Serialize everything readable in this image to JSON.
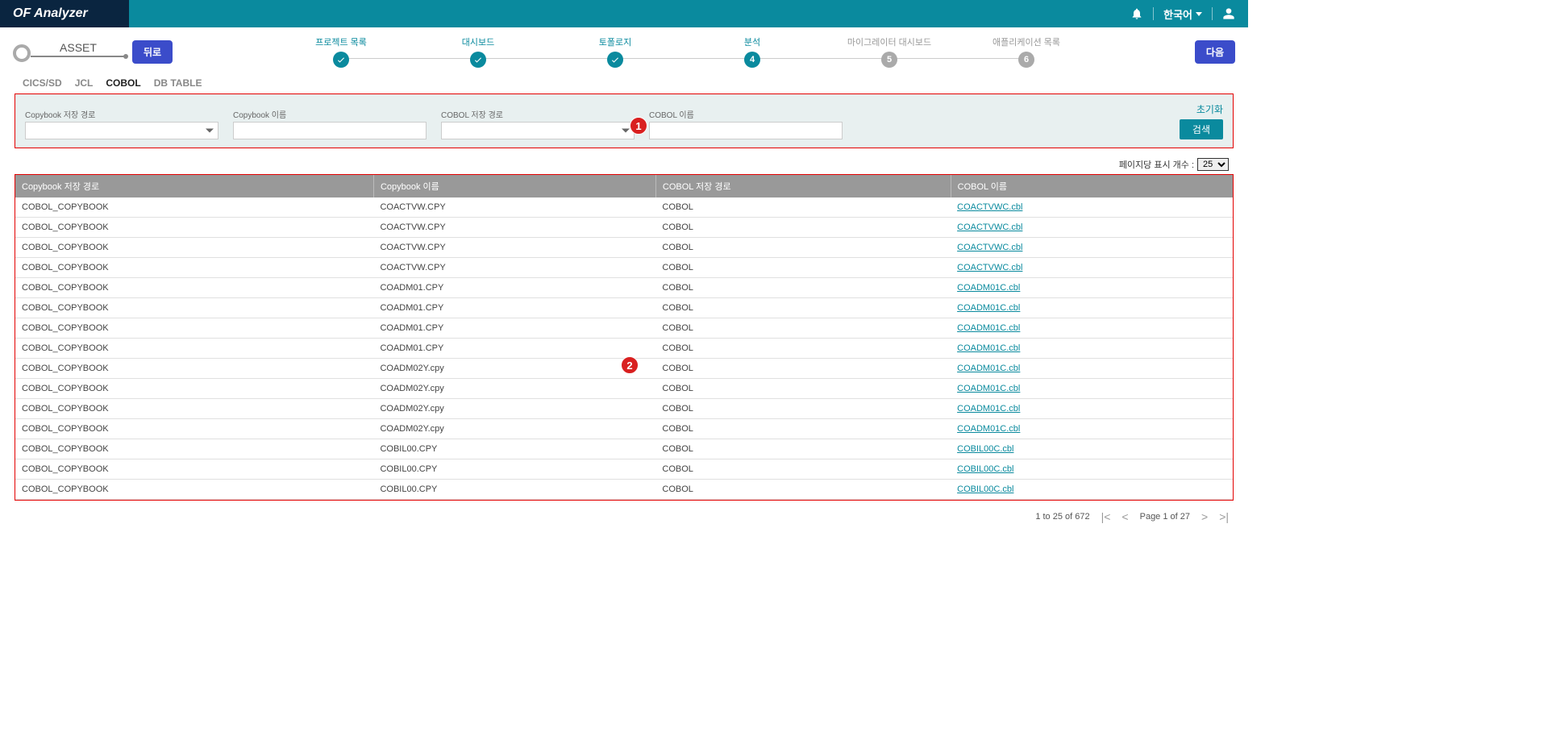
{
  "app_title": "OF Analyzer",
  "language": "한국어",
  "asset_label": "ASSET",
  "back_btn": "뒤로",
  "next_btn": "다음",
  "steps": [
    {
      "label": "프로젝트 목록",
      "state": "done",
      "mark": "check"
    },
    {
      "label": "대시보드",
      "state": "done",
      "mark": "check"
    },
    {
      "label": "토폴로지",
      "state": "done",
      "mark": "check"
    },
    {
      "label": "분석",
      "state": "done",
      "mark": "4"
    },
    {
      "label": "마이그레이터 대시보드",
      "state": "inactive",
      "mark": "5"
    },
    {
      "label": "애플리케이션 목록",
      "state": "inactive",
      "mark": "6"
    }
  ],
  "tabs": [
    "CICS/SD",
    "JCL",
    "COBOL",
    "DB TABLE"
  ],
  "active_tab": "COBOL",
  "filters": {
    "copybook_path_label": "Copybook 저장 경로",
    "copybook_name_label": "Copybook 이름",
    "cobol_path_label": "COBOL 저장 경로",
    "cobol_name_label": "COBOL 이름",
    "reset": "초기화",
    "search": "검색"
  },
  "page_size_label": "페이지당 표시 개수 :",
  "page_size_value": "25",
  "columns": [
    "Copybook 저장 경로",
    "Copybook 이름",
    "COBOL 저장 경로",
    "COBOL 이름"
  ],
  "rows": [
    [
      "COBOL_COPYBOOK",
      "COACTVW.CPY",
      "COBOL",
      "COACTVWC.cbl"
    ],
    [
      "COBOL_COPYBOOK",
      "COACTVW.CPY",
      "COBOL",
      "COACTVWC.cbl"
    ],
    [
      "COBOL_COPYBOOK",
      "COACTVW.CPY",
      "COBOL",
      "COACTVWC.cbl"
    ],
    [
      "COBOL_COPYBOOK",
      "COACTVW.CPY",
      "COBOL",
      "COACTVWC.cbl"
    ],
    [
      "COBOL_COPYBOOK",
      "COADM01.CPY",
      "COBOL",
      "COADM01C.cbl"
    ],
    [
      "COBOL_COPYBOOK",
      "COADM01.CPY",
      "COBOL",
      "COADM01C.cbl"
    ],
    [
      "COBOL_COPYBOOK",
      "COADM01.CPY",
      "COBOL",
      "COADM01C.cbl"
    ],
    [
      "COBOL_COPYBOOK",
      "COADM01.CPY",
      "COBOL",
      "COADM01C.cbl"
    ],
    [
      "COBOL_COPYBOOK",
      "COADM02Y.cpy",
      "COBOL",
      "COADM01C.cbl"
    ],
    [
      "COBOL_COPYBOOK",
      "COADM02Y.cpy",
      "COBOL",
      "COADM01C.cbl"
    ],
    [
      "COBOL_COPYBOOK",
      "COADM02Y.cpy",
      "COBOL",
      "COADM01C.cbl"
    ],
    [
      "COBOL_COPYBOOK",
      "COADM02Y.cpy",
      "COBOL",
      "COADM01C.cbl"
    ],
    [
      "COBOL_COPYBOOK",
      "COBIL00.CPY",
      "COBOL",
      "COBIL00C.cbl"
    ],
    [
      "COBOL_COPYBOOK",
      "COBIL00.CPY",
      "COBOL",
      "COBIL00C.cbl"
    ],
    [
      "COBOL_COPYBOOK",
      "COBIL00.CPY",
      "COBOL",
      "COBIL00C.cbl"
    ]
  ],
  "pager": {
    "range": "1 to 25 of 672",
    "page": "Page 1 of 27"
  },
  "callouts": {
    "c1": "1",
    "c2": "2"
  }
}
